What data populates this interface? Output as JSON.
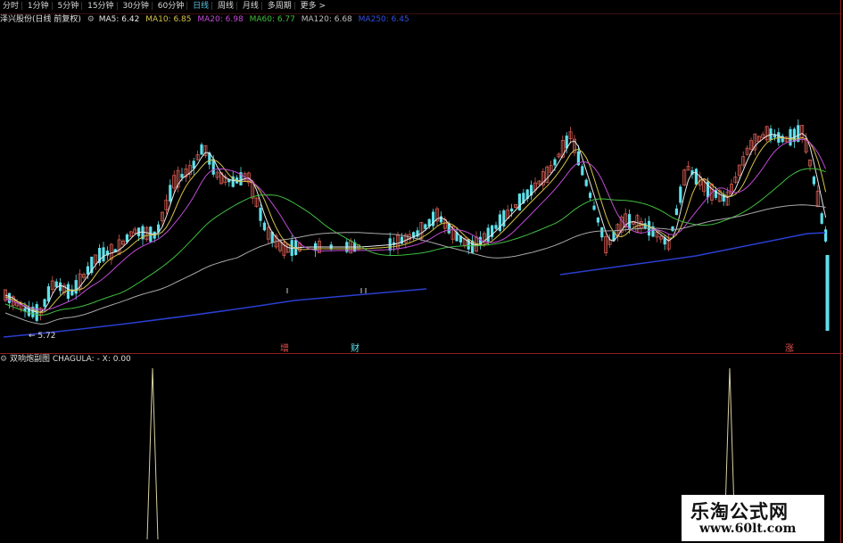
{
  "colors": {
    "up": "#d05a50",
    "down": "#5ee0ea",
    "ma5": "#e6e6e6",
    "ma10": "#d6c24a",
    "ma20": "#c14ad6",
    "ma60": "#3fbf3f",
    "ma120": "#a8a8a8",
    "ma250": "#2a3fd0",
    "osc": "#d8d0a0"
  },
  "toolbar": {
    "tabs": [
      "分时",
      "1分钟",
      "5分钟",
      "15分钟",
      "30分钟",
      "60分钟",
      "日线",
      "周线",
      "月线",
      "多周期",
      "更多 >"
    ],
    "active": "日线"
  },
  "info": {
    "stock": "泽兴股份(日线 前复权)",
    "gear_icon": "gear-icon",
    "ma5": "MA5: 6.42",
    "ma10": "MA10: 6.85",
    "ma20": "MA20: 6.98",
    "ma60": "MA60: 6.77",
    "ma120": "MA120: 6.68",
    "ma250": "MA250: 6.45"
  },
  "chart": {
    "low_label": "← 5.72",
    "markers": [
      {
        "text": "增"
      },
      {
        "text": "财"
      },
      {
        "text": "涨"
      }
    ]
  },
  "sub": {
    "title": "双响炮副图",
    "indicator": "CHAGULA: - X: 0.00"
  },
  "watermark": {
    "title": "乐淘公式网",
    "url": "www.60lt.com"
  }
}
